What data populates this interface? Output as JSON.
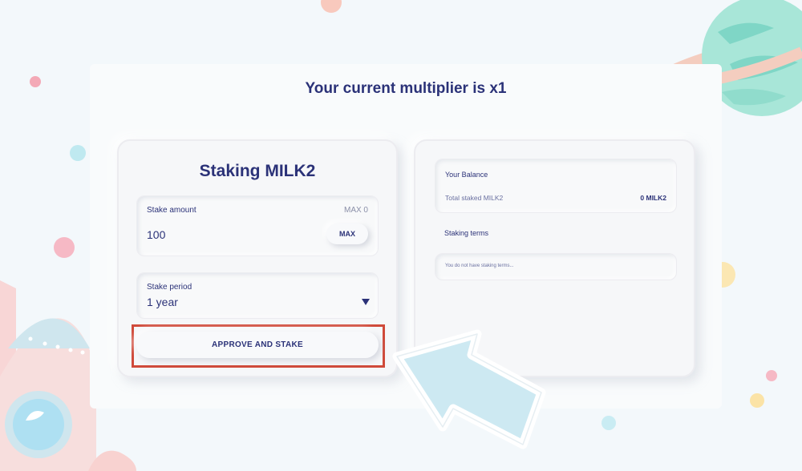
{
  "header": {
    "multiplier_text": "Your current multiplier is x1"
  },
  "staking_card": {
    "title": "Staking MILK2",
    "stake_amount_label": "Stake amount",
    "max_info": "MAX 0",
    "amount_value": "100",
    "max_button_label": "MAX",
    "stake_period_label": "Stake period",
    "stake_period_value": "1 year",
    "approve_button_label": "APPROVE AND STAKE"
  },
  "balance_card": {
    "title": "Your Balance",
    "total_staked_label": "Total staked MILK2",
    "total_staked_value": "0 MILK2",
    "staking_terms_title": "Staking terms",
    "staking_terms_empty": "You do not have staking terms..."
  },
  "colors": {
    "brand_navy": "#2b3278",
    "highlight_red": "#d04a3a",
    "pointer_blue": "#cde9f2",
    "planet_mint": "#a8e6d8",
    "ring_peach": "#f4cdbf"
  },
  "icons": [
    "caret-down-icon",
    "planet-decoration",
    "rocket-decoration",
    "pointer-arrow-icon"
  ]
}
